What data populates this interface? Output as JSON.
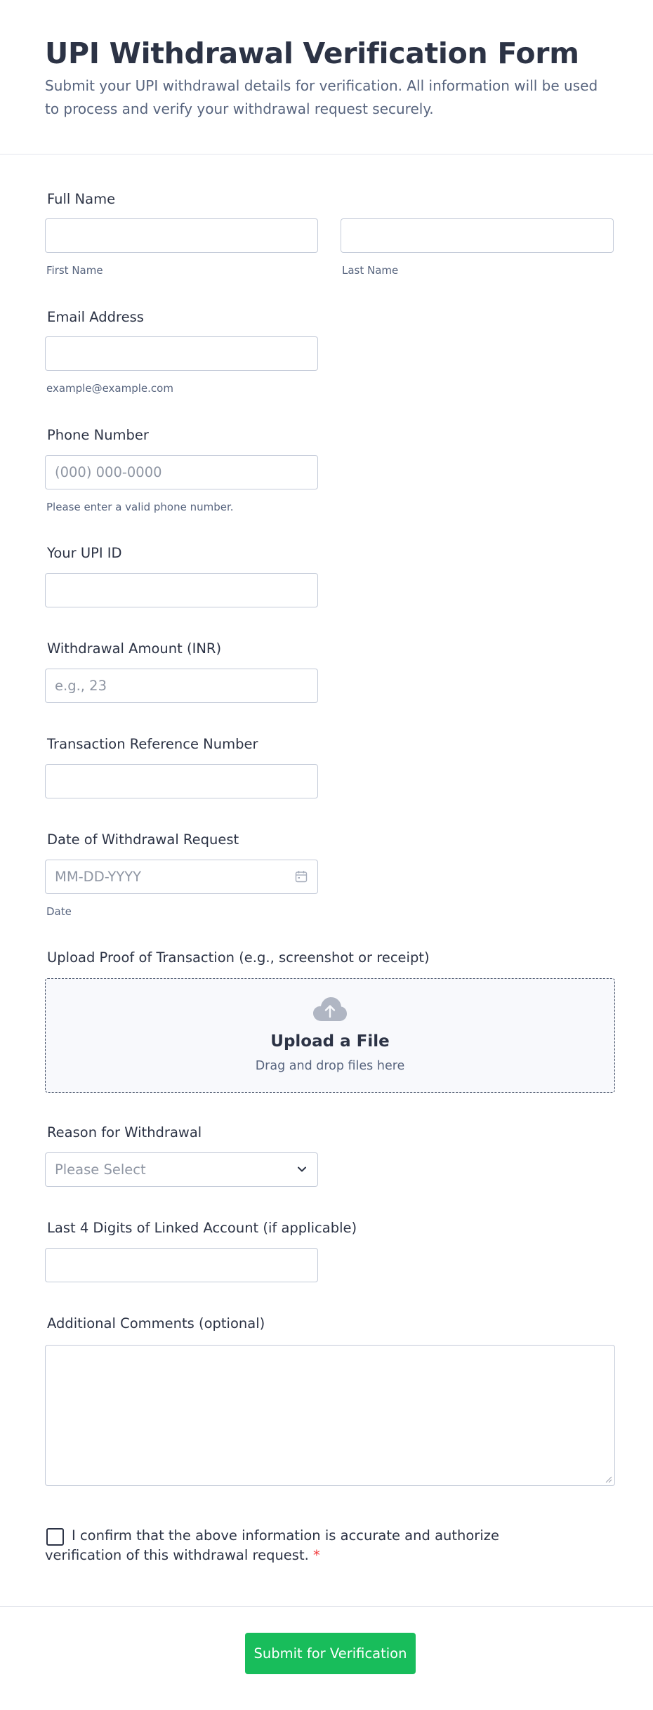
{
  "form": {
    "title": "UPI Withdrawal Verification Form",
    "subtitle": "Submit your UPI withdrawal details for verification. All information will be used to process and verify your withdrawal request securely."
  },
  "fields": {
    "full_name": {
      "label": "Full Name",
      "first_value": "",
      "last_value": "",
      "first_sublabel": "First Name",
      "last_sublabel": "Last Name"
    },
    "email": {
      "label": "Email Address",
      "value": "",
      "sublabel": "example@example.com"
    },
    "phone": {
      "label": "Phone Number",
      "placeholder": "(000) 000-0000",
      "sublabel": "Please enter a valid phone number."
    },
    "upi_id": {
      "label": "Your UPI ID",
      "value": ""
    },
    "amount": {
      "label": "Withdrawal Amount (INR)",
      "placeholder": "e.g., 23"
    },
    "reference": {
      "label": "Transaction Reference Number",
      "value": ""
    },
    "date": {
      "label": "Date of Withdrawal Request",
      "placeholder": "MM-DD-YYYY",
      "sublabel": "Date",
      "icon": "calendar-icon"
    },
    "upload": {
      "label": "Upload Proof of Transaction (e.g., screenshot or receipt)",
      "title": "Upload a File",
      "subtitle": "Drag and drop files here",
      "icon": "cloud-upload-icon"
    },
    "reason": {
      "label": "Reason for Withdrawal",
      "selected": "Please Select",
      "icon": "chevron-down-icon"
    },
    "last4": {
      "label": "Last 4 Digits of Linked Account (if applicable)",
      "value": ""
    },
    "comments": {
      "label": "Additional Comments (optional)",
      "value": ""
    },
    "consent": {
      "text": "I confirm that the above information is accurate and authorize verification of this withdrawal request.",
      "required_mark": "*",
      "checked": false
    }
  },
  "submit": {
    "label": "Submit for Verification"
  },
  "colors": {
    "accent": "#18bd5b",
    "text": "#2c3345",
    "muted": "#57647e",
    "border": "#c3cad8",
    "required": "#f23a3c"
  }
}
